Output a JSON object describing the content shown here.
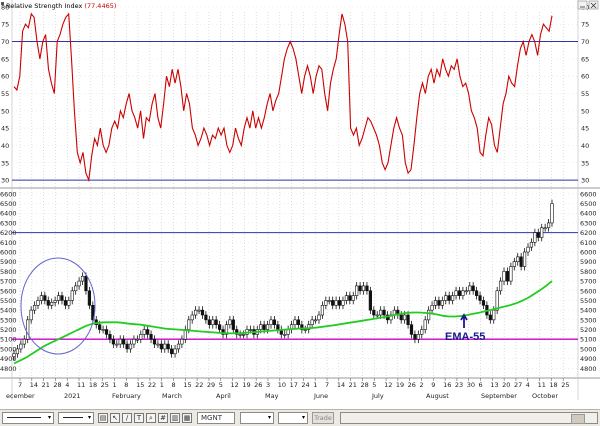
{
  "chart_data": [
    {
      "type": "line",
      "title": "Relative Strength Index",
      "title_value": "(77.4465)",
      "yticks": [
        30,
        35,
        40,
        45,
        50,
        55,
        60,
        65,
        70,
        75,
        80
      ],
      "ylim": [
        28,
        82
      ],
      "reference_lines": [
        70,
        30
      ],
      "series": [
        {
          "color": "#cc0000",
          "values": [
            57,
            56,
            60,
            73,
            75,
            74,
            78,
            77,
            70,
            65,
            70,
            72,
            62,
            58,
            55,
            70,
            72,
            75,
            77,
            78,
            65,
            50,
            38,
            35,
            38,
            32,
            30,
            37,
            42,
            40,
            45,
            40,
            38,
            40,
            45,
            47,
            45,
            50,
            48,
            52,
            55,
            50,
            48,
            45,
            50,
            42,
            48,
            47,
            52,
            55,
            48,
            45,
            52,
            60,
            57,
            62,
            58,
            62,
            57,
            50,
            55,
            52,
            45,
            43,
            40,
            42,
            45,
            43,
            40,
            43,
            42,
            45,
            43,
            45,
            40,
            38,
            40,
            45,
            42,
            40,
            45,
            48,
            45,
            50,
            45,
            48,
            45,
            48,
            52,
            55,
            50,
            53,
            55,
            60,
            65,
            68,
            70,
            68,
            65,
            60,
            55,
            60,
            63,
            60,
            55,
            60,
            63,
            62,
            55,
            50,
            58,
            62,
            65,
            72,
            78,
            75,
            70,
            45,
            43,
            45,
            40,
            42,
            45,
            48,
            47,
            45,
            43,
            40,
            35,
            33,
            35,
            40,
            45,
            48,
            45,
            43,
            35,
            32,
            33,
            40,
            48,
            55,
            58,
            55,
            60,
            62,
            58,
            62,
            60,
            65,
            62,
            60,
            63,
            62,
            65,
            60,
            57,
            58,
            55,
            50,
            48,
            45,
            38,
            37,
            43,
            48,
            46,
            40,
            38,
            45,
            52,
            55,
            60,
            58,
            57,
            63,
            68,
            70,
            66,
            70,
            72,
            70,
            66,
            72,
            75,
            74,
            73,
            77.4465
          ]
        }
      ]
    },
    {
      "type": "candlestick",
      "yticks": [
        4800,
        4900,
        5000,
        5100,
        5200,
        5300,
        5400,
        5500,
        5600,
        5700,
        5800,
        5900,
        6000,
        6100,
        6200,
        6300,
        6400,
        6500,
        6600
      ],
      "ylim": [
        4700,
        6650
      ],
      "reference_lines": [
        6200,
        5100
      ],
      "ema_label": "EMA-55",
      "ema_color": "#22cc22",
      "close": [
        4950,
        5000,
        5050,
        5100,
        5300,
        5400,
        5450,
        5500,
        5550,
        5500,
        5450,
        5480,
        5500,
        5550,
        5500,
        5450,
        5500,
        5600,
        5650,
        5700,
        5750,
        5600,
        5450,
        5300,
        5250,
        5200,
        5200,
        5150,
        5100,
        5050,
        5050,
        5100,
        5050,
        5000,
        5050,
        5100,
        5100,
        5150,
        5200,
        5150,
        5100,
        5050,
        5050,
        5000,
        5050,
        5000,
        4950,
        5000,
        5050,
        5100,
        5200,
        5300,
        5350,
        5400,
        5400,
        5350,
        5300,
        5250,
        5300,
        5250,
        5200,
        5150,
        5250,
        5300,
        5200,
        5150,
        5150,
        5150,
        5200,
        5200,
        5150,
        5200,
        5250,
        5200,
        5250,
        5300,
        5250,
        5200,
        5150,
        5150,
        5200,
        5250,
        5300,
        5250,
        5200,
        5200,
        5250,
        5300,
        5300,
        5350,
        5450,
        5500,
        5500,
        5450,
        5500,
        5450,
        5500,
        5550,
        5500,
        5550,
        5650,
        5600,
        5650,
        5600,
        5400,
        5350,
        5350,
        5400,
        5350,
        5300,
        5350,
        5400,
        5350,
        5300,
        5350,
        5250,
        5150,
        5100,
        5150,
        5200,
        5300,
        5400,
        5450,
        5500,
        5450,
        5500,
        5550,
        5500,
        5550,
        5600,
        5550,
        5600,
        5600,
        5650,
        5600,
        5550,
        5500,
        5450,
        5350,
        5300,
        5400,
        5600,
        5700,
        5800,
        5700,
        5850,
        5900,
        5950,
        5850,
        6000,
        6050,
        6100,
        6200,
        6150,
        6250,
        6250,
        6300,
        6500
      ],
      "ema_values": [
        4850,
        4880,
        4910,
        4950,
        4990,
        5030,
        5060,
        5090,
        5120,
        5150,
        5180,
        5210,
        5240,
        5260,
        5270,
        5275,
        5275,
        5275,
        5270,
        5260,
        5255,
        5250,
        5240,
        5230,
        5220,
        5210,
        5205,
        5200,
        5195,
        5190,
        5185,
        5180,
        5175,
        5170,
        5165,
        5162,
        5160,
        5160,
        5165,
        5170,
        5175,
        5180,
        5185,
        5190,
        5195,
        5200,
        5205,
        5210,
        5212,
        5215,
        5220,
        5228,
        5236,
        5245,
        5255,
        5265,
        5275,
        5285,
        5295,
        5305,
        5315,
        5325,
        5338,
        5350,
        5362,
        5372,
        5376,
        5376,
        5372,
        5365,
        5355,
        5342,
        5335,
        5335,
        5340,
        5350,
        5362,
        5375,
        5390,
        5405,
        5420,
        5435,
        5450,
        5470,
        5495,
        5525,
        5565,
        5605,
        5650,
        5700
      ]
    }
  ],
  "month_labels": [
    "ecember",
    "2021",
    "February",
    "March",
    "April",
    "May",
    "June",
    "July",
    "August",
    "September",
    "October"
  ],
  "day_labels": [
    "7",
    "14",
    "21",
    "28",
    "4",
    "11",
    "18",
    "25",
    "1",
    "8",
    "15",
    "22",
    "1",
    "8",
    "15",
    "22",
    "29",
    "5",
    "12",
    "19",
    "26",
    "3",
    "10",
    "17",
    "24",
    "1",
    "7",
    "14",
    "21",
    "28",
    "5",
    "12",
    "19",
    "26",
    "2",
    "9",
    "16",
    "23",
    "30",
    "6",
    "13",
    "20",
    "27",
    "4",
    "11",
    "18",
    "25"
  ],
  "toolbar": {
    "symbol": "MGNT",
    "trade_label": "Trade"
  },
  "colors": {
    "rsi": "#cc0000",
    "reference_blue": "#3333aa",
    "reference_magenta": "#cc00cc",
    "ema": "#22cc22",
    "circle": "#6666cc",
    "annotation": "#1a1a8c"
  }
}
